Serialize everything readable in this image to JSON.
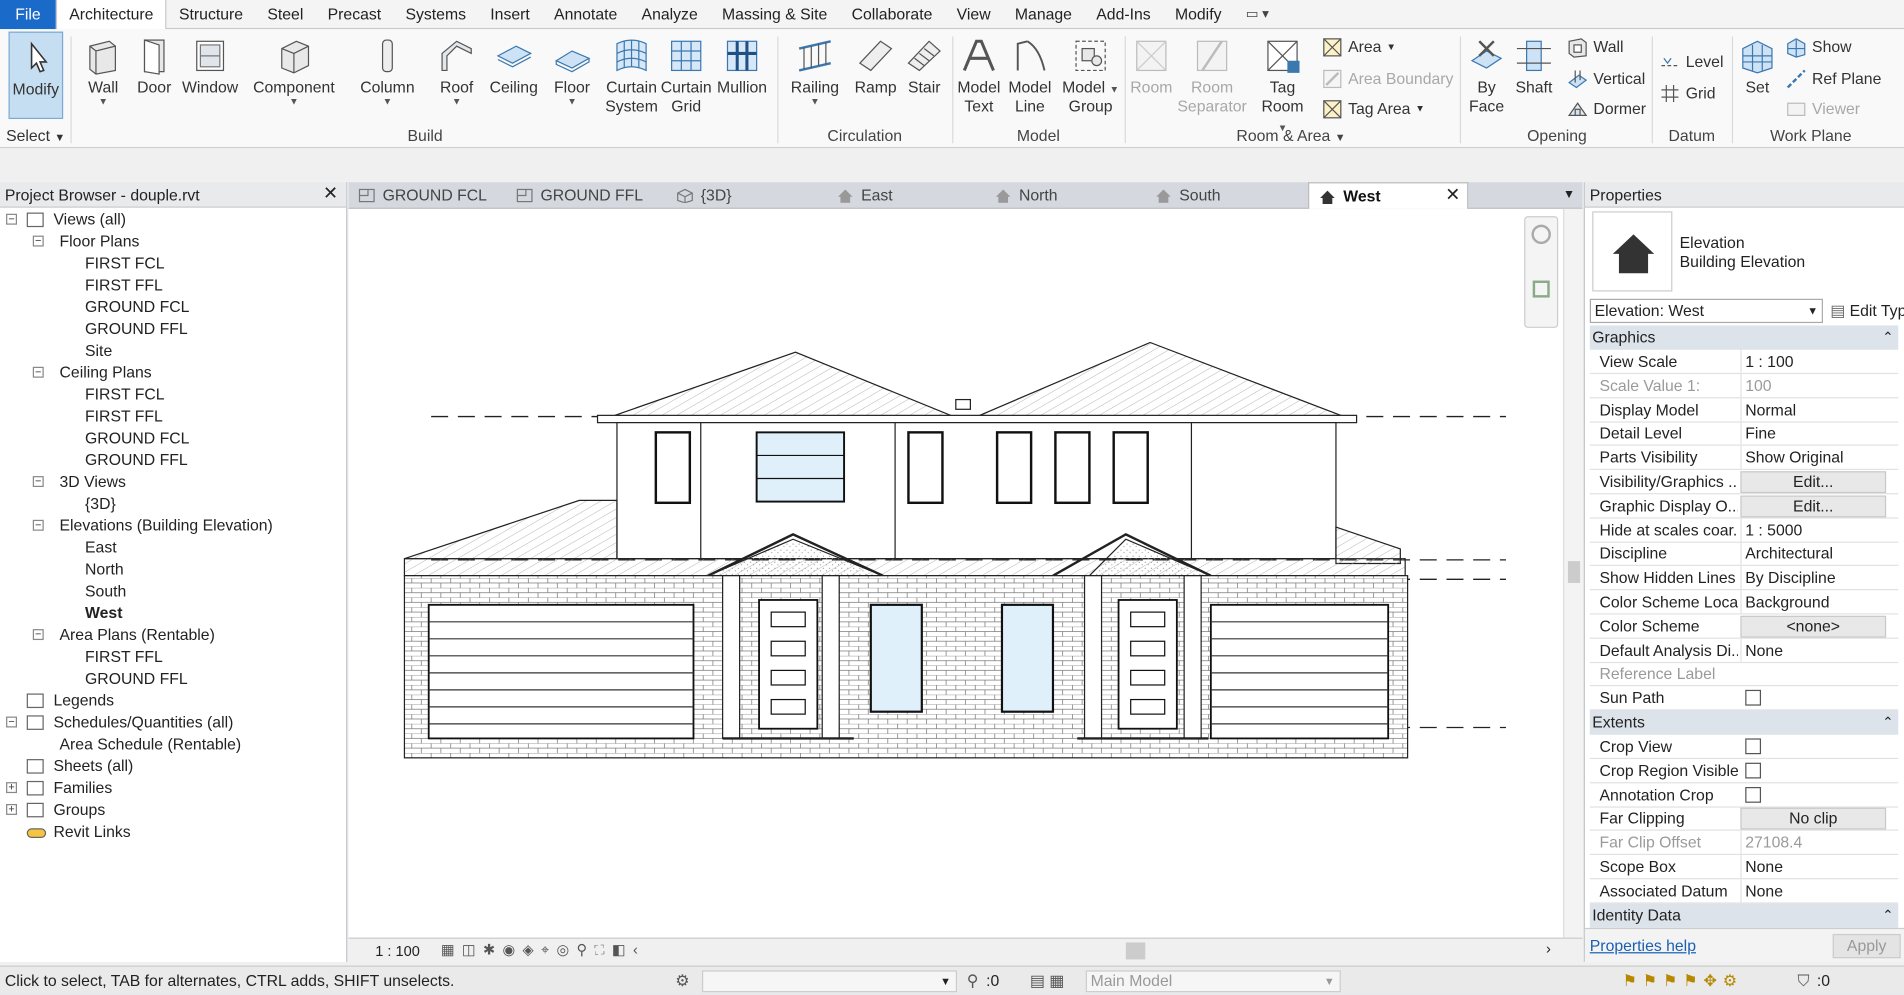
{
  "menu": {
    "file": "File",
    "tabs": [
      "Architecture",
      "Structure",
      "Steel",
      "Precast",
      "Systems",
      "Insert",
      "Annotate",
      "Analyze",
      "Massing & Site",
      "Collaborate",
      "View",
      "Manage",
      "Add-Ins",
      "Modify"
    ],
    "active_tab": "Architecture"
  },
  "ribbon": {
    "select": {
      "modify": "Modify",
      "label": "Select"
    },
    "build": {
      "wall": "Wall",
      "door": "Door",
      "window": "Window",
      "component": "Component",
      "column": "Column",
      "roof": "Roof",
      "ceiling": "Ceiling",
      "floor": "Floor",
      "curtain_system_1": "Curtain",
      "curtain_system_2": "System",
      "curtain_grid_1": "Curtain",
      "curtain_grid_2": "Grid",
      "mullion": "Mullion",
      "label": "Build"
    },
    "circulation": {
      "railing": "Railing",
      "ramp": "Ramp",
      "stair": "Stair",
      "label": "Circulation"
    },
    "model": {
      "model_text_1": "Model",
      "model_text_2": "Text",
      "model_line_1": "Model",
      "model_line_2": "Line",
      "model_group_1": "Model",
      "model_group_2": "Group",
      "label": "Model"
    },
    "room_area": {
      "room": "Room",
      "room_sep_1": "Room",
      "room_sep_2": "Separator",
      "tag_room_1": "Tag",
      "tag_room_2": "Room",
      "area": "Area",
      "area_boundary": "Area  Boundary",
      "tag_area": "Tag  Area",
      "label": "Room & Area"
    },
    "opening": {
      "by_face_1": "By",
      "by_face_2": "Face",
      "shaft": "Shaft",
      "wall": "Wall",
      "vertical": "Vertical",
      "dormer": "Dormer",
      "label": "Opening"
    },
    "datum": {
      "level": "Level",
      "grid": "Grid",
      "label": "Datum"
    },
    "work_plane": {
      "set": "Set",
      "show": "Show",
      "ref_plane": "Ref  Plane",
      "viewer": "Viewer",
      "label": "Work Plane"
    }
  },
  "project_browser": {
    "title": "Project Browser - douple.rvt",
    "items": [
      {
        "label": "Views (all)"
      },
      {
        "label": "Floor Plans"
      },
      {
        "label": "FIRST FCL"
      },
      {
        "label": "FIRST FFL"
      },
      {
        "label": "GROUND FCL"
      },
      {
        "label": "GROUND FFL"
      },
      {
        "label": "Site"
      },
      {
        "label": "Ceiling Plans"
      },
      {
        "label": "FIRST FCL"
      },
      {
        "label": "FIRST FFL"
      },
      {
        "label": "GROUND FCL"
      },
      {
        "label": "GROUND FFL"
      },
      {
        "label": "3D Views"
      },
      {
        "label": "{3D}"
      },
      {
        "label": "Elevations (Building Elevation)"
      },
      {
        "label": "East"
      },
      {
        "label": "North"
      },
      {
        "label": "South"
      },
      {
        "label": "West"
      },
      {
        "label": "Area Plans (Rentable)"
      },
      {
        "label": "FIRST FFL"
      },
      {
        "label": "GROUND FFL"
      },
      {
        "label": "Legends"
      },
      {
        "label": "Schedules/Quantities (all)"
      },
      {
        "label": "Area Schedule (Rentable)"
      },
      {
        "label": "Sheets (all)"
      },
      {
        "label": "Families"
      },
      {
        "label": "Groups"
      },
      {
        "label": "Revit Links"
      }
    ]
  },
  "view_tabs": [
    "GROUND FCL",
    "GROUND FFL",
    "{3D}",
    "East",
    "North",
    "South",
    "West"
  ],
  "view_status": {
    "scale": "1 : 100"
  },
  "properties": {
    "title": "Properties",
    "type_name_1": "Elevation",
    "type_name_2": "Building Elevation",
    "selector": "Elevation: West",
    "edit_type": "Edit Type",
    "groups": {
      "graphics": "Graphics",
      "extents": "Extents",
      "identity": "Identity Data"
    },
    "rows": [
      {
        "k": "View Scale",
        "v": "1 : 100"
      },
      {
        "k": "Scale Value    1:",
        "v": "100"
      },
      {
        "k": "Display Model",
        "v": "Normal"
      },
      {
        "k": "Detail Level",
        "v": "Fine"
      },
      {
        "k": "Parts Visibility",
        "v": "Show Original"
      },
      {
        "k": "Visibility/Graphics ...",
        "v": "Edit..."
      },
      {
        "k": "Graphic Display O...",
        "v": "Edit..."
      },
      {
        "k": "Hide at scales coar...",
        "v": "1 : 5000"
      },
      {
        "k": "Discipline",
        "v": "Architectural"
      },
      {
        "k": "Show Hidden Lines",
        "v": "By Discipline"
      },
      {
        "k": "Color Scheme Loca...",
        "v": "Background"
      },
      {
        "k": "Color Scheme",
        "v": "<none>"
      },
      {
        "k": "Default Analysis Di...",
        "v": "None"
      },
      {
        "k": "Reference Label",
        "v": ""
      },
      {
        "k": "Sun Path",
        "v": ""
      },
      {
        "k": "Crop View",
        "v": ""
      },
      {
        "k": "Crop Region Visible",
        "v": ""
      },
      {
        "k": "Annotation Crop",
        "v": ""
      },
      {
        "k": "Far Clipping",
        "v": "No clip"
      },
      {
        "k": "Far Clip Offset",
        "v": "27108.4"
      },
      {
        "k": "Scope Box",
        "v": "None"
      },
      {
        "k": "Associated Datum",
        "v": "None"
      }
    ],
    "help": "Properties help",
    "apply": "Apply"
  },
  "statusbar": {
    "hint": "Click to select, TAB for alternates, CTRL adds, SHIFT unselects.",
    "count": ":0",
    "model": "Main Model",
    "filter": ":0"
  },
  "colors": {
    "file_blue": "#1a6ac9",
    "link_blue": "#1a5fb4",
    "ribbon_bg": "#f9f9f9"
  }
}
